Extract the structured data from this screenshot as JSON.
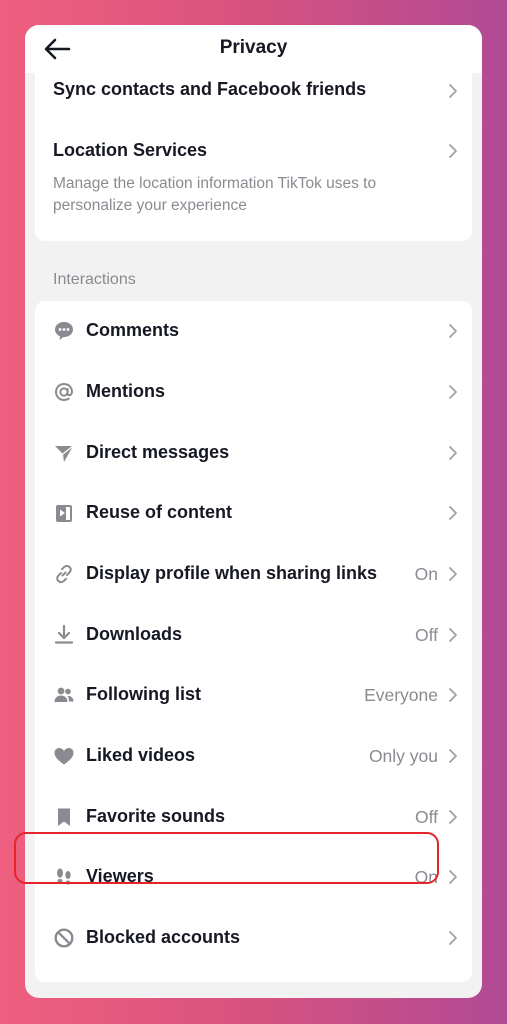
{
  "header": {
    "title": "Privacy"
  },
  "top_card": {
    "sync_title": "Sync contacts and Facebook friends",
    "location_title": "Location Services",
    "location_desc": "Manage the location information TikTok uses to personalize your experience"
  },
  "interactions": {
    "section_label": "Interactions",
    "items": [
      {
        "label": "Comments",
        "value": "",
        "icon": "comment-icon"
      },
      {
        "label": "Mentions",
        "value": "",
        "icon": "at-icon"
      },
      {
        "label": "Direct messages",
        "value": "",
        "icon": "send-icon"
      },
      {
        "label": "Reuse of content",
        "value": "",
        "icon": "reuse-icon"
      },
      {
        "label": "Display profile when sharing links",
        "value": "On",
        "icon": "link-icon"
      },
      {
        "label": "Downloads",
        "value": "Off",
        "icon": "download-icon"
      },
      {
        "label": "Following list",
        "value": "Everyone",
        "icon": "people-icon"
      },
      {
        "label": "Liked videos",
        "value": "Only you",
        "icon": "heart-icon"
      },
      {
        "label": "Favorite sounds",
        "value": "Off",
        "icon": "bookmark-icon"
      },
      {
        "label": "Viewers",
        "value": "On",
        "icon": "footprints-icon"
      },
      {
        "label": "Blocked accounts",
        "value": "",
        "icon": "block-icon"
      }
    ]
  },
  "colors": {
    "highlight": "#e3242b",
    "icon_gray": "#8a8b91",
    "text": "#161823"
  }
}
